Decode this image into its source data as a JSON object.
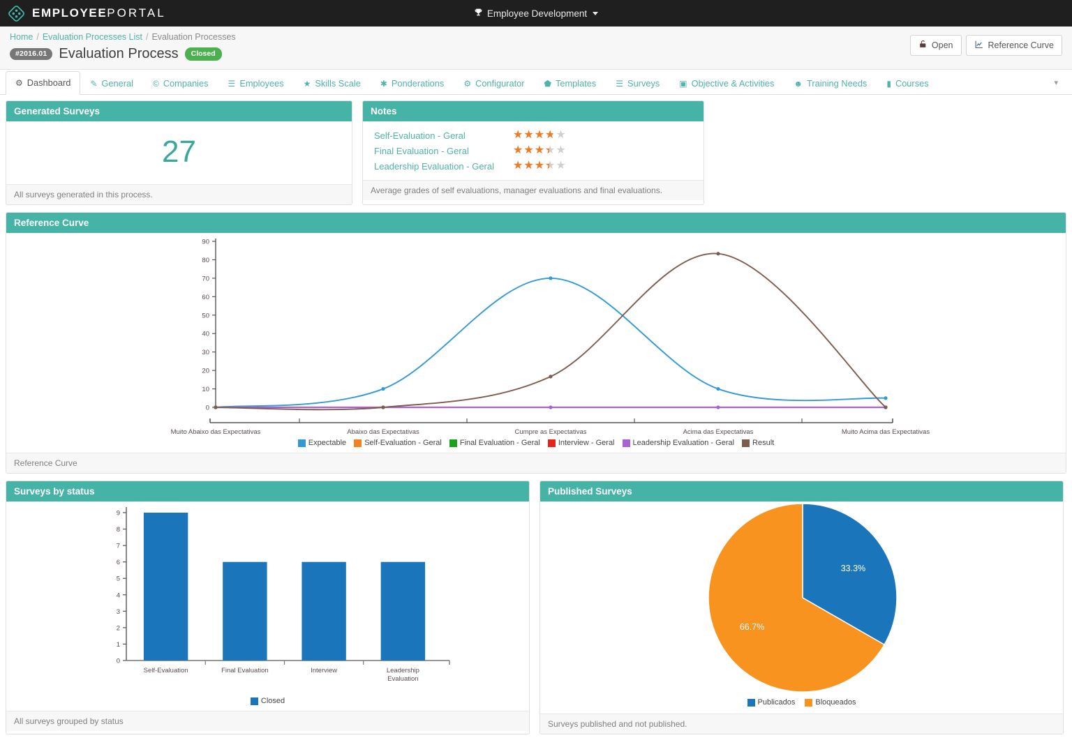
{
  "topbar": {
    "brand_bold": "EMPLOYEE",
    "brand_light": "PORTAL",
    "logo_icon": "diamond-logo-icon",
    "nav_item": "Employee Development",
    "nav_icon": "trophy-icon",
    "caret_icon": "caret-down-icon"
  },
  "breadcrumb": {
    "home": "Home",
    "list": "Evaluation Processes List",
    "current": "Evaluation Processes",
    "separator": "/"
  },
  "header": {
    "id_badge": "#2016.01",
    "title": "Evaluation Process",
    "status": "Closed",
    "status_color": "#4caf50",
    "actions": [
      {
        "label": "Open",
        "icon": "unlock-icon"
      },
      {
        "label": "Reference Curve",
        "icon": "line-chart-icon"
      }
    ]
  },
  "tabs": [
    {
      "label": "Dashboard",
      "icon": "dashboard-icon",
      "glyph": "⚙",
      "active": true
    },
    {
      "label": "General",
      "icon": "edit-icon",
      "glyph": "✎",
      "active": false
    },
    {
      "label": "Companies",
      "icon": "copyright-icon",
      "glyph": "©",
      "active": false
    },
    {
      "label": "Employees",
      "icon": "list-icon",
      "glyph": "☰",
      "active": false
    },
    {
      "label": "Skills Scale",
      "icon": "star-icon",
      "glyph": "★",
      "active": false
    },
    {
      "label": "Ponderations",
      "icon": "asterisk-icon",
      "glyph": "✱",
      "active": false
    },
    {
      "label": "Configurator",
      "icon": "gear-icon",
      "glyph": "⚙",
      "active": false
    },
    {
      "label": "Templates",
      "icon": "shield-icon",
      "glyph": "⬟",
      "active": false
    },
    {
      "label": "Surveys",
      "icon": "list-icon",
      "glyph": "☰",
      "active": false
    },
    {
      "label": "Objective & Activities",
      "icon": "target-icon",
      "glyph": "▣",
      "active": false
    },
    {
      "label": "Training Needs",
      "icon": "users-icon",
      "glyph": "☻",
      "active": false
    },
    {
      "label": "Courses",
      "icon": "book-icon",
      "glyph": "▮",
      "active": false
    }
  ],
  "tabs_overflow_icon": "caret-down-icon",
  "generated_surveys": {
    "title": "Generated Surveys",
    "value": "27",
    "footer": "All surveys generated in this process."
  },
  "notes": {
    "title": "Notes",
    "items": [
      {
        "label": "Self-Evaluation - Geral",
        "rating": 3.7
      },
      {
        "label": "Final Evaluation - Geral",
        "rating": 3.4
      },
      {
        "label": "Leadership Evaluation - Geral",
        "rating": 3.4
      }
    ],
    "star_max": 5,
    "star_fill_color": "#f07a22",
    "star_empty_color": "#cfcfcf",
    "footer": "Average grades of self evaluations, manager evaluations and final evaluations."
  },
  "reference_curve_panel": {
    "title": "Reference Curve",
    "footer": "Reference Curve"
  },
  "surveys_by_status_panel": {
    "title": "Surveys by status",
    "footer": "All surveys grouped by status"
  },
  "published_surveys_panel": {
    "title": "Published Surveys",
    "footer": "Surveys published and not published."
  },
  "chart_data": [
    {
      "id": "reference-curve",
      "type": "line",
      "title": "Reference Curve",
      "xlabel": "",
      "ylabel": "",
      "ylim": [
        0,
        90
      ],
      "yticks": [
        0,
        10,
        20,
        30,
        40,
        50,
        60,
        70,
        80,
        90
      ],
      "grid": false,
      "legend_position": "bottom",
      "categories": [
        "Muito Abaixo das Expectativas",
        "Abaixo das Expectativas",
        "Cumpre as Expectativas",
        "Acima das Expectativas",
        "Muito Acima das Expectativas"
      ],
      "series": [
        {
          "name": "Expectable",
          "color": "#3399d6",
          "values": [
            0,
            10,
            70,
            10,
            5
          ]
        },
        {
          "name": "Self-Evaluation - Geral",
          "color": "#f58220",
          "values": [
            0,
            0,
            0,
            0,
            0
          ]
        },
        {
          "name": "Final Evaluation - Geral",
          "color": "#1ba21b",
          "values": [
            0,
            0,
            0,
            0,
            0
          ]
        },
        {
          "name": "Interview - Geral",
          "color": "#e8231a",
          "values": [
            0,
            0,
            0,
            0,
            0
          ]
        },
        {
          "name": "Leadership Evaluation - Geral",
          "color": "#a960d4",
          "values": [
            0,
            0,
            0,
            0,
            0
          ]
        },
        {
          "name": "Result",
          "color": "#7d5c4e",
          "values": [
            0,
            0,
            16.7,
            83.3,
            0
          ]
        }
      ]
    },
    {
      "id": "surveys-by-status",
      "type": "bar",
      "title": "Surveys by status",
      "xlabel": "",
      "ylabel": "",
      "ylim": [
        0,
        9
      ],
      "yticks": [
        0,
        1,
        2,
        3,
        4,
        5,
        6,
        7,
        8,
        9
      ],
      "grid": false,
      "legend_position": "bottom",
      "categories": [
        "Self-Evaluation",
        "Final Evaluation",
        "Interview",
        "Leadership Evaluation"
      ],
      "series": [
        {
          "name": "Closed",
          "color": "#1b75ba",
          "values": [
            9,
            6,
            6,
            6
          ]
        }
      ]
    },
    {
      "id": "published-surveys",
      "type": "pie",
      "title": "Published Surveys",
      "legend_position": "bottom",
      "labels": [
        "Publicados",
        "Bloqueados"
      ],
      "values": [
        33.3,
        66.7
      ],
      "value_labels": [
        "33.3%",
        "66.7%"
      ],
      "colors": [
        "#1b75ba",
        "#f7931e"
      ]
    }
  ]
}
